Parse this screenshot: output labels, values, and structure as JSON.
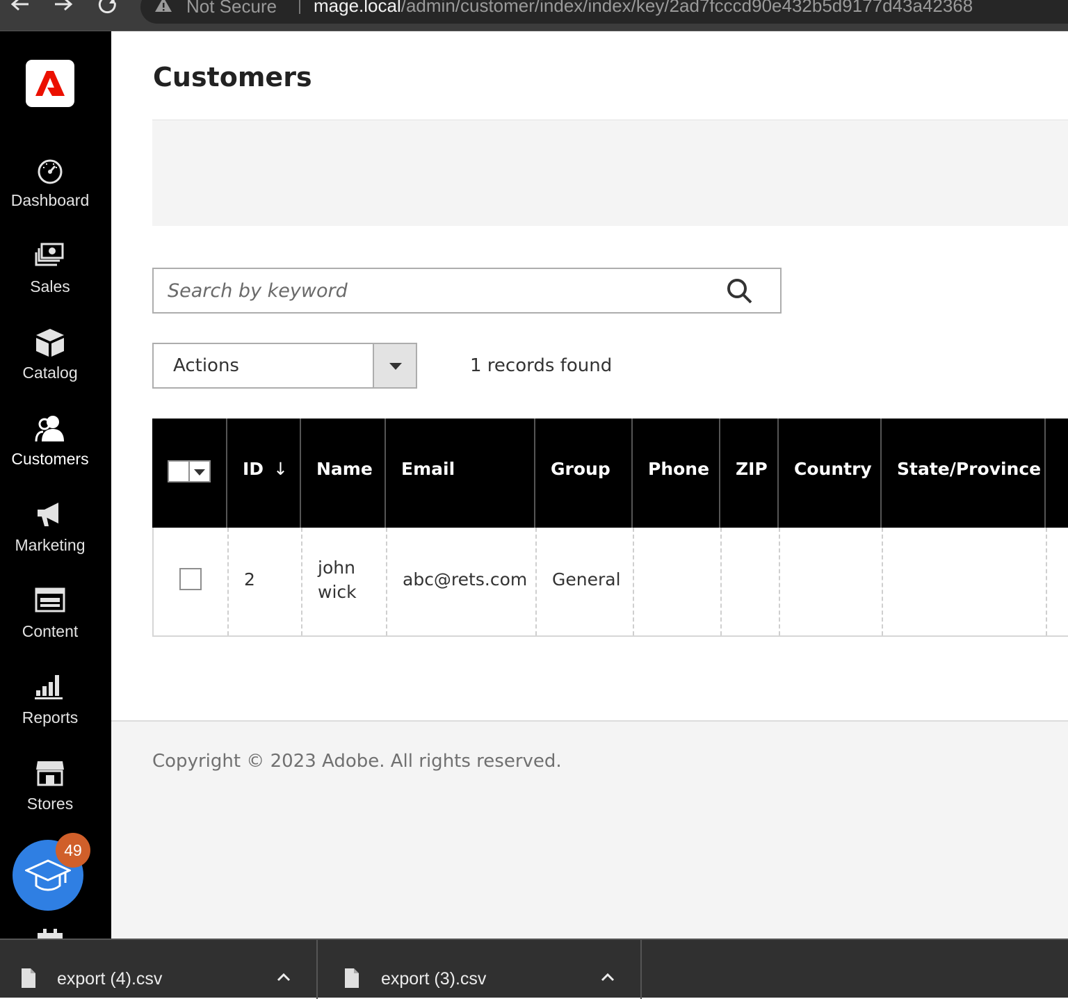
{
  "browser": {
    "security_label": "Not Secure",
    "url_host": "mage.local",
    "url_path": "/admin/customer/index/index/key/2ad7fcccd90e432b5d9177d43a42368"
  },
  "sidebar": {
    "items": [
      {
        "label": "Dashboard",
        "icon": "dashboard-icon"
      },
      {
        "label": "Sales",
        "icon": "sales-icon"
      },
      {
        "label": "Catalog",
        "icon": "catalog-icon"
      },
      {
        "label": "Customers",
        "icon": "customers-icon"
      },
      {
        "label": "Marketing",
        "icon": "marketing-icon"
      },
      {
        "label": "Content",
        "icon": "content-icon"
      },
      {
        "label": "Reports",
        "icon": "reports-icon"
      },
      {
        "label": "Stores",
        "icon": "stores-icon"
      }
    ],
    "learn_badge": "49"
  },
  "page": {
    "title": "Customers"
  },
  "search": {
    "placeholder": "Search by keyword"
  },
  "toolbar": {
    "actions_label": "Actions",
    "records_found": "1 records found"
  },
  "grid": {
    "columns": [
      "ID",
      "Name",
      "Email",
      "Group",
      "Phone",
      "ZIP",
      "Country",
      "State/Province"
    ],
    "sort_indicator": "↓",
    "rows": [
      {
        "id": "2",
        "name_line1": "john",
        "name_line2": "wick",
        "email": "abc@rets.com",
        "group": "General",
        "phone": "",
        "zip": "",
        "country": "",
        "state": ""
      }
    ]
  },
  "footer": {
    "copyright": "Copyright © 2023 Adobe. All rights reserved."
  },
  "downloads": [
    {
      "filename": "export (4).csv"
    },
    {
      "filename": "export (3).csv"
    }
  ],
  "colors": {
    "sidebar_bg": "#000000",
    "brand_red": "#eb1000",
    "learn_blue": "#2f7fe3",
    "badge_orange": "#d05f2a"
  }
}
